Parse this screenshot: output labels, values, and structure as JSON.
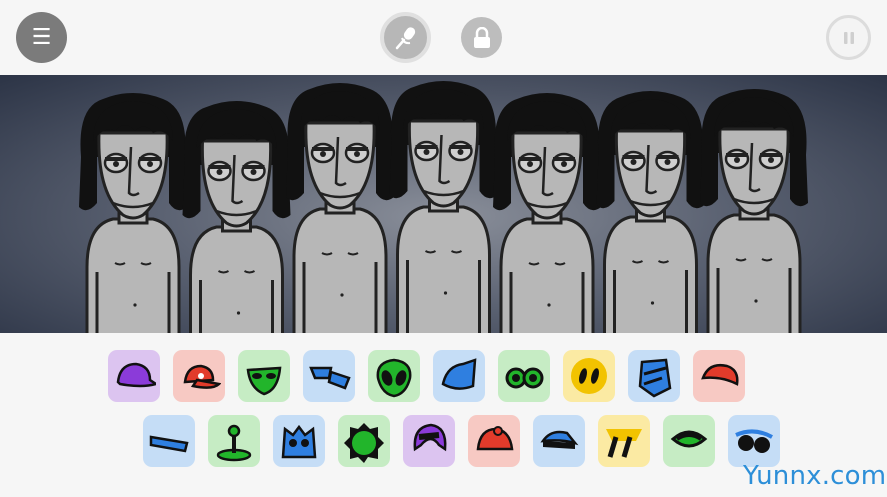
{
  "toolbar": {
    "menu_glyph": "☰",
    "mic_icon": "microphone-icon",
    "lock_icon": "lock-icon",
    "pause_icon": "pause-icon"
  },
  "stage": {
    "character_count": 7,
    "background_colors": [
      "#8a8f9a",
      "#5b6272",
      "#2c3446"
    ]
  },
  "palette": {
    "row1": [
      {
        "name": "purple-cap",
        "category": "purple"
      },
      {
        "name": "red-cap",
        "category": "red"
      },
      {
        "name": "green-alien-face",
        "category": "green"
      },
      {
        "name": "blue-glasses",
        "category": "blue"
      },
      {
        "name": "green-alien-head",
        "category": "green"
      },
      {
        "name": "blue-helmet",
        "category": "blue"
      },
      {
        "name": "green-goggles",
        "category": "green"
      },
      {
        "name": "yellow-eyes",
        "category": "yellow"
      },
      {
        "name": "blue-robot-head",
        "category": "blue"
      },
      {
        "name": "red-beret",
        "category": "red"
      }
    ],
    "row2": [
      {
        "name": "blue-headband",
        "category": "blue"
      },
      {
        "name": "green-joystick",
        "category": "green"
      },
      {
        "name": "blue-monster-face",
        "category": "blue"
      },
      {
        "name": "green-blob",
        "category": "green"
      },
      {
        "name": "purple-hood",
        "category": "purple"
      },
      {
        "name": "red-helmet",
        "category": "red"
      },
      {
        "name": "blue-cap",
        "category": "blue"
      },
      {
        "name": "yellow-slash-eyes",
        "category": "yellow"
      },
      {
        "name": "green-visor",
        "category": "green"
      },
      {
        "name": "blue-sunglasses",
        "category": "blue"
      }
    ]
  },
  "watermark": "Yunnx.com"
}
